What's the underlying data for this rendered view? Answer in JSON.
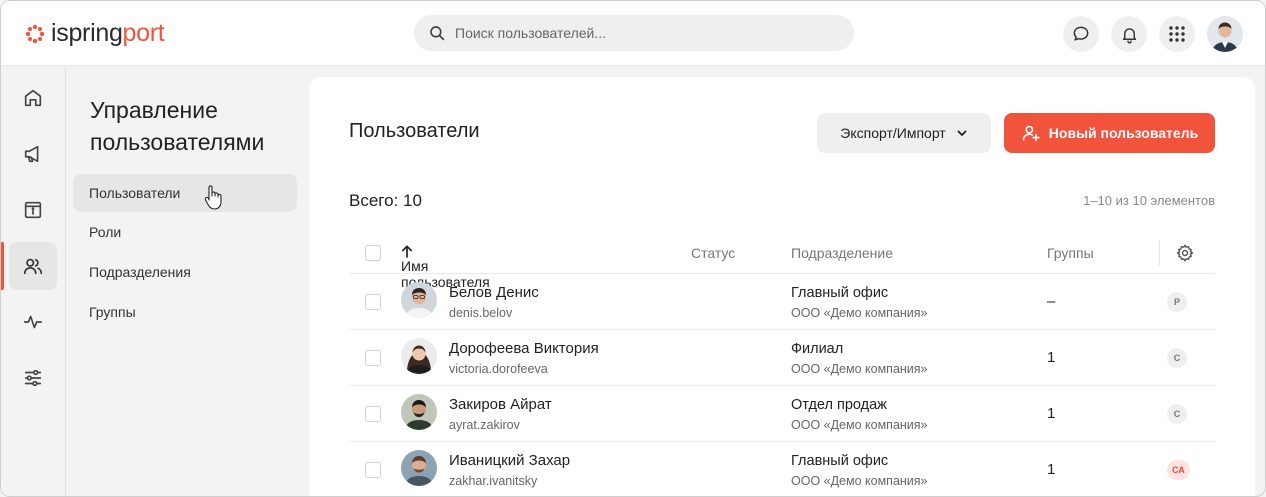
{
  "app": {
    "logo_part1": "ispring",
    "logo_part2": "port",
    "brand_color": "#f2533c"
  },
  "search": {
    "placeholder": "Поиск пользователей..."
  },
  "topbar": {
    "icons": [
      "chat-icon",
      "bell-icon",
      "apps-grid-icon"
    ]
  },
  "rail": {
    "icons": [
      "home-icon",
      "megaphone-icon",
      "catalog-icon",
      "users-icon",
      "activity-icon",
      "sliders-icon"
    ],
    "active": "users-icon"
  },
  "subnav": {
    "title": "Управление пользователями",
    "items": [
      {
        "label": "Пользователи",
        "active": true
      },
      {
        "label": "Роли"
      },
      {
        "label": "Подразделения"
      },
      {
        "label": "Группы"
      }
    ]
  },
  "main": {
    "title": "Пользователи",
    "export_label": "Экспорт/Импорт",
    "new_user_label": "Новый пользователь",
    "total_label": "Всего: 10",
    "pager_label": "1–10 из 10 элементов",
    "columns": {
      "name": "Имя пользователя",
      "status": "Статус",
      "department": "Подразделение",
      "groups": "Группы"
    },
    "rows": [
      {
        "name": "Белов Денис",
        "login": "denis.belov",
        "department": "Главный офис",
        "org": "ООО «Демо компания»",
        "groups": "–",
        "badge": "Р",
        "badge_accent": false
      },
      {
        "name": "Дорофеева Виктория",
        "login": "victoria.dorofeeva",
        "department": "Филиал",
        "org": "ООО «Демо компания»",
        "groups": "1",
        "badge": "С",
        "badge_accent": false
      },
      {
        "name": "Закиров Айрат",
        "login": "ayrat.zakirov",
        "department": "Отдел продаж",
        "org": "ООО «Демо компания»",
        "groups": "1",
        "badge": "С",
        "badge_accent": false
      },
      {
        "name": "Иваницкий Захар",
        "login": "zakhar.ivanitsky",
        "department": "Главный офис",
        "org": "ООО «Демо компания»",
        "groups": "1",
        "badge": "СА",
        "badge_accent": true
      }
    ]
  }
}
